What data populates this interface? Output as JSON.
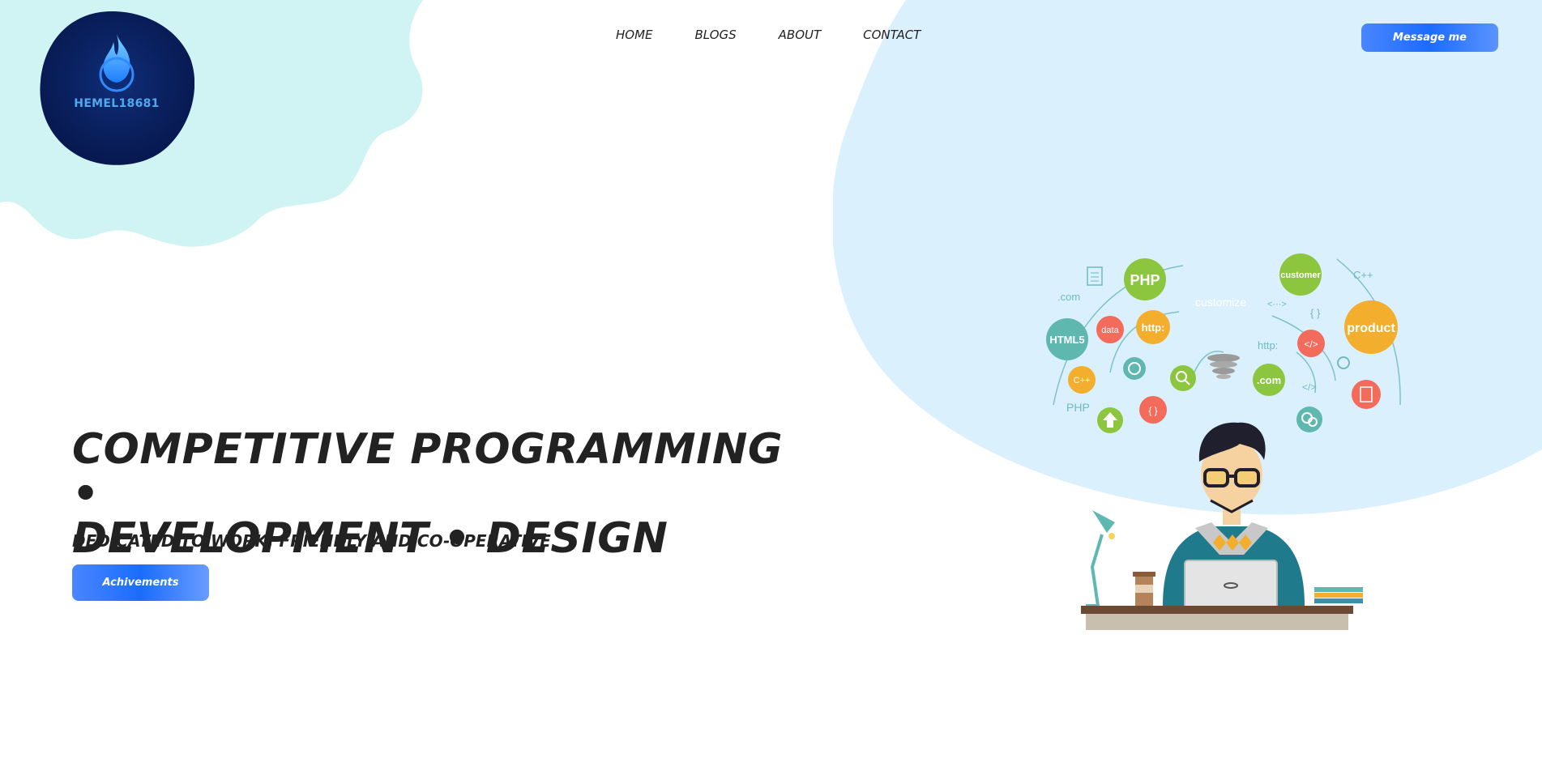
{
  "brand": {
    "logo_text": "HEMEL18681"
  },
  "nav": {
    "items": [
      "HOME",
      "BLOGS",
      "ABOUT",
      "CONTACT"
    ]
  },
  "header": {
    "cta_label": "Message me"
  },
  "hero": {
    "title_line1": "COMPETITIVE PROGRAMMING •",
    "title_line2": "DEVELOPMENT • DESIGN",
    "subtitle": "DEDICATED TO WORK, FRIENDLY AND CO-OPERATIVE",
    "button_label": "Achivements"
  },
  "illustration": {
    "labels": {
      "php": "PHP",
      "customer": "customer",
      "cpp_top": "C++",
      "dotcom_left": ".com",
      "customize": "customize",
      "arrows": "<···>",
      "braces_right": "{ }",
      "html5": "HTML5",
      "data": "data",
      "http_circle": "http:",
      "product": "product",
      "http_text": "http:",
      "code_circle": "</>",
      "cpp_circle": "C++",
      "php_text": "PHP",
      "dotcom_circle": ".com",
      "code_text": "</>",
      "braces_circle": "{ }"
    }
  },
  "colors": {
    "accent": "#1a6cff",
    "blob_left": "#cff4f3",
    "blob_right": "#dbf0fd",
    "logo_bg": "#0a1f5c",
    "text": "#222222"
  }
}
